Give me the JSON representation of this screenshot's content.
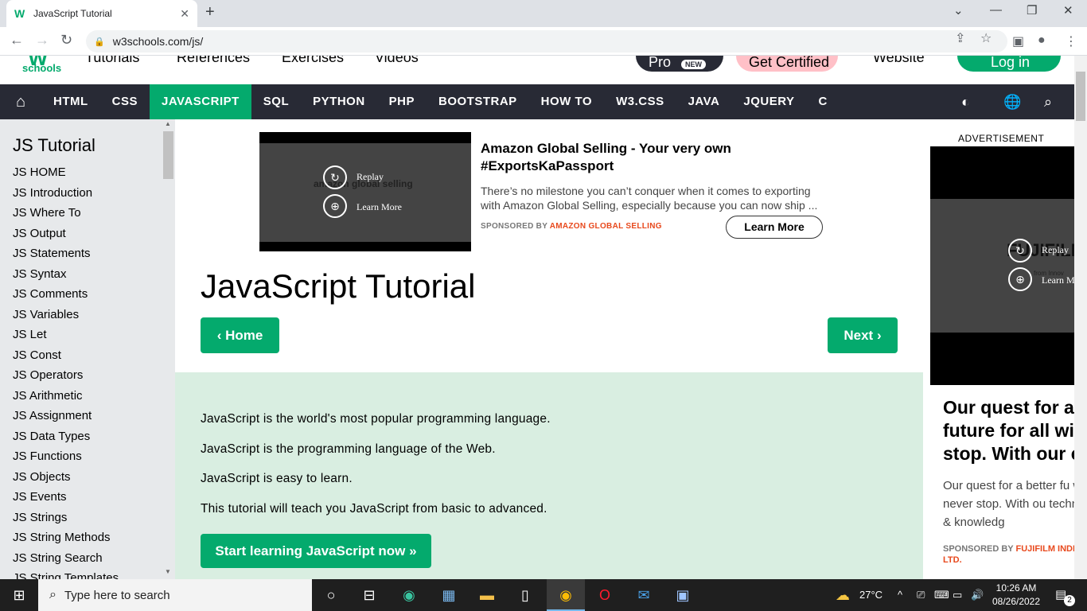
{
  "browser": {
    "tab_title": "JavaScript Tutorial",
    "url": "w3schools.com/js/"
  },
  "header": {
    "logo": "schools",
    "links": [
      "Tutorials",
      "References",
      "Exercises",
      "Videos"
    ],
    "pro": "Pro",
    "pro_badge": "NEW",
    "certified": "Get Certified",
    "website": "Website",
    "login": "Log in"
  },
  "topnav": {
    "items": [
      "HTML",
      "CSS",
      "JAVASCRIPT",
      "SQL",
      "PYTHON",
      "PHP",
      "BOOTSTRAP",
      "HOW TO",
      "W3.CSS",
      "JAVA",
      "JQUERY",
      "C"
    ],
    "active": "JAVASCRIPT"
  },
  "sidebar": {
    "title": "JS Tutorial",
    "items": [
      "JS HOME",
      "JS Introduction",
      "JS Where To",
      "JS Output",
      "JS Statements",
      "JS Syntax",
      "JS Comments",
      "JS Variables",
      "JS Let",
      "JS Const",
      "JS Operators",
      "JS Arithmetic",
      "JS Assignment",
      "JS Data Types",
      "JS Functions",
      "JS Objects",
      "JS Events",
      "JS Strings",
      "JS String Methods",
      "JS String Search",
      "JS String Templates"
    ]
  },
  "ad": {
    "replay": "Replay",
    "learn_more_video": "Learn More",
    "video_brand": "amazon global selling",
    "title": "Amazon Global Selling - Your very own #ExportsKaPassport",
    "desc": "There’s no milestone you can’t conquer when it comes to exporting with Amazon Global Selling, especially because you can now ship ...",
    "sponsored_by": "SPONSORED BY",
    "sponsor": "AMAZON GLOBAL SELLING",
    "learn_more": "Learn More"
  },
  "main": {
    "title": "JavaScript Tutorial",
    "prev": "Home",
    "next": "Next",
    "intro": [
      "JavaScript is the world's most popular programming language.",
      "JavaScript is the programming language of the Web.",
      "JavaScript is easy to learn.",
      "This tutorial will teach you JavaScript from basic to advanced."
    ],
    "cta": "Start learning JavaScript now »"
  },
  "right_ad": {
    "label": "ADVERTISEMENT",
    "replay": "Replay",
    "learn_more": "Learn M",
    "brand": "FUJIFILM",
    "brand_sub": "from Innov",
    "headline": "Our quest for a future for all wi stop. With our e",
    "body": "Our quest for a better fu will never stop. With ou technology & knowledg",
    "sponsored_by": "SPONSORED BY",
    "sponsor": "FUJIFILM INDIA PVT. LTD."
  },
  "taskbar": {
    "search_placeholder": "Type here to search",
    "temperature": "27°C",
    "time": "10:26 AM",
    "date": "08/26/2022",
    "notifications": "2"
  },
  "colors": {
    "brand_green": "#04aa6d",
    "nav_dark": "#282a35",
    "sidebar_bg": "#e7e9eb",
    "intro_bg": "#d9eee1",
    "sponsor_orange": "#e8491d"
  }
}
